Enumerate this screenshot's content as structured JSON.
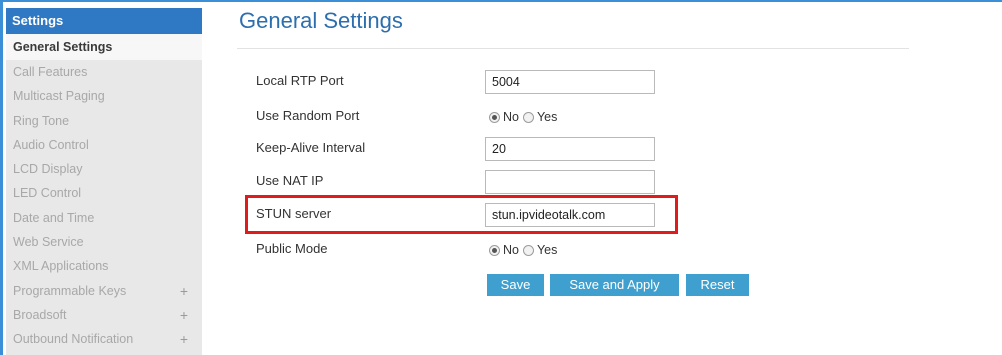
{
  "sidebar": {
    "header": "Settings",
    "items": [
      {
        "label": "General Settings",
        "active": true
      },
      {
        "label": "Call Features"
      },
      {
        "label": "Multicast Paging"
      },
      {
        "label": "Ring Tone"
      },
      {
        "label": "Audio Control"
      },
      {
        "label": "LCD Display"
      },
      {
        "label": "LED Control"
      },
      {
        "label": "Date and Time"
      },
      {
        "label": "Web Service"
      },
      {
        "label": "XML Applications"
      },
      {
        "label": "Programmable Keys",
        "expand": "+"
      },
      {
        "label": "Broadsoft",
        "expand": "+"
      },
      {
        "label": "Outbound Notification",
        "expand": "+"
      }
    ]
  },
  "main": {
    "title": "General Settings",
    "fields": {
      "local_rtp_port": {
        "label": "Local RTP Port",
        "value": "5004"
      },
      "use_random_port": {
        "label": "Use Random Port",
        "option_no": "No",
        "option_yes": "Yes",
        "selected": "No"
      },
      "keep_alive": {
        "label": "Keep-Alive Interval",
        "value": "20"
      },
      "use_nat_ip": {
        "label": "Use NAT IP",
        "value": ""
      },
      "stun_server": {
        "label": "STUN server",
        "value": "stun.ipvideotalk.com"
      },
      "public_mode": {
        "label": "Public Mode",
        "option_no": "No",
        "option_yes": "Yes",
        "selected": "No"
      }
    },
    "buttons": {
      "save": "Save",
      "save_apply": "Save and Apply",
      "reset": "Reset"
    }
  },
  "colors": {
    "accent": "#2f78c4",
    "title": "#2d6fae",
    "button": "#3fa0cf",
    "highlight": "#e01b1b"
  }
}
